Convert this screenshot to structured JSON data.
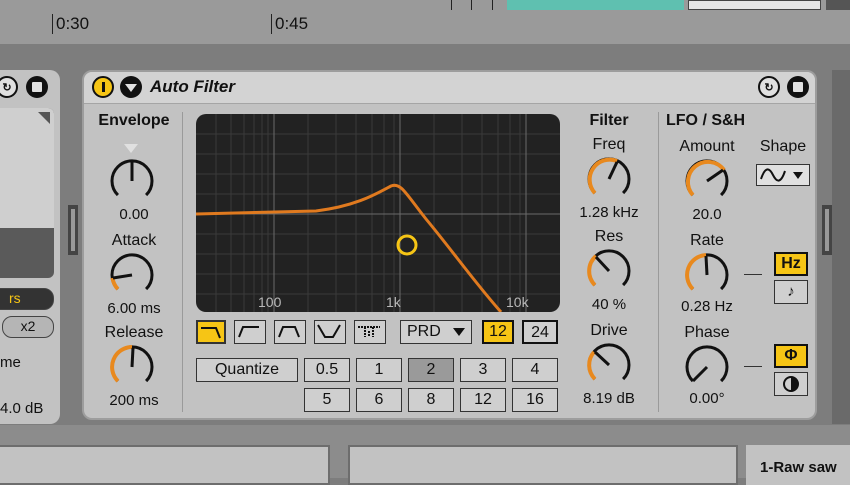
{
  "timeline": {
    "marks": [
      "0:30",
      "0:45"
    ]
  },
  "left_device": {
    "partial_label_1": "rs",
    "partial_label_2": "x2",
    "partial_label_3": "me",
    "partial_label_4": "4.0 dB"
  },
  "device": {
    "title": "Auto Filter",
    "envelope": {
      "header": "Envelope",
      "amount_value": "0.00",
      "attack_label": "Attack",
      "attack_value": "6.00 ms",
      "release_label": "Release",
      "release_value": "200 ms"
    },
    "graph": {
      "freq_labels": [
        "100",
        "1k",
        "10k"
      ]
    },
    "filter_types": [
      "lowpass",
      "bandpass",
      "highpass",
      "notch",
      "morph"
    ],
    "circuit": {
      "selected": "PRD"
    },
    "slope_options": [
      "12",
      "24"
    ],
    "slope_selected": "12",
    "quantize": {
      "label": "Quantize",
      "values": [
        "0.5",
        "1",
        "2",
        "3",
        "4",
        "5",
        "6",
        "8",
        "12",
        "16"
      ],
      "selected": "2"
    },
    "filter_section": {
      "header": "Filter",
      "freq_label": "Freq",
      "freq_value": "1.28 kHz",
      "res_label": "Res",
      "res_value": "40 %",
      "drive_label": "Drive",
      "drive_value": "8.19 dB"
    },
    "lfo": {
      "header": "LFO / S&H",
      "amount_label": "Amount",
      "amount_value": "20.0",
      "shape_label": "Shape",
      "rate_label": "Rate",
      "rate_value": "0.28 Hz",
      "hz_label": "Hz",
      "phase_label": "Phase",
      "phase_value": "0.00°",
      "phi_label": "Φ"
    }
  },
  "bottom": {
    "track_label": "1-Raw saw"
  },
  "colors": {
    "accent_yellow": "#f6c515",
    "knob_orange": "#e8891e",
    "curve_orange": "#e07a1f",
    "panel": "#c2c2c2",
    "graph_bg": "#222222"
  }
}
